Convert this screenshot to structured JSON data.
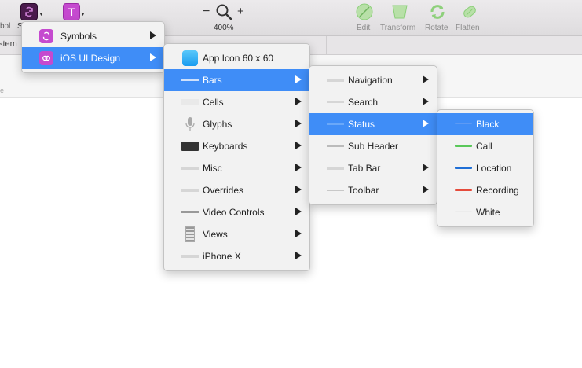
{
  "toolbar": {
    "symbol_label_fragment": "bol",
    "symbols_btn_fragment": "S",
    "text_btn_glyph": "T",
    "zoom_minus": "−",
    "zoom_plus": "+",
    "zoom_level": "400%",
    "tools": [
      {
        "label": "Edit"
      },
      {
        "label": "Transform"
      },
      {
        "label": "Rotate"
      },
      {
        "label": "Flatten"
      }
    ]
  },
  "tabbar": {
    "left_fragment": "stem"
  },
  "colors": {
    "accent": "#3f8df7",
    "insert_purple": "#c54acf",
    "call_green": "#5ac85a",
    "location_blue": "#1f6fd6",
    "recording_red": "#e54b3b",
    "tool_green": "#8ed07b"
  },
  "menu1": {
    "items": [
      {
        "label": "Symbols",
        "icon": "symbol-icon",
        "submenu": true,
        "selected": false
      },
      {
        "label": "iOS UI Design",
        "icon": "symbol-link-icon",
        "submenu": true,
        "selected": true
      }
    ]
  },
  "menu2": {
    "items": [
      {
        "label": "App Icon 60 x 60",
        "icon": "app-icon"
      },
      {
        "label": "Bars",
        "icon": "bar-icon",
        "submenu": true,
        "selected": true
      },
      {
        "label": "Cells",
        "icon": "cell-icon",
        "submenu": true
      },
      {
        "label": "Glyphs",
        "icon": "microphone-icon",
        "submenu": true
      },
      {
        "label": "Keyboards",
        "icon": "keyboard-icon",
        "submenu": true
      },
      {
        "label": "Misc",
        "icon": "misc-icon",
        "submenu": true
      },
      {
        "label": "Overrides",
        "icon": "overrides-icon",
        "submenu": true
      },
      {
        "label": "Video Controls",
        "icon": "video-controls-icon",
        "submenu": true
      },
      {
        "label": "Views",
        "icon": "views-icon",
        "submenu": true
      },
      {
        "label": "iPhone X",
        "icon": "iphone-x-icon",
        "submenu": true
      }
    ]
  },
  "menu3": {
    "items": [
      {
        "label": "Navigation",
        "submenu": true
      },
      {
        "label": "Search",
        "submenu": true
      },
      {
        "label": "Status",
        "submenu": true,
        "selected": true
      },
      {
        "label": "Sub Header",
        "submenu": false
      },
      {
        "label": "Tab Bar",
        "submenu": true
      },
      {
        "label": "Toolbar",
        "submenu": true
      }
    ]
  },
  "menu4": {
    "items": [
      {
        "label": "Black",
        "selected": true
      },
      {
        "label": "Call"
      },
      {
        "label": "Location"
      },
      {
        "label": "Recording"
      },
      {
        "label": "White"
      }
    ]
  }
}
